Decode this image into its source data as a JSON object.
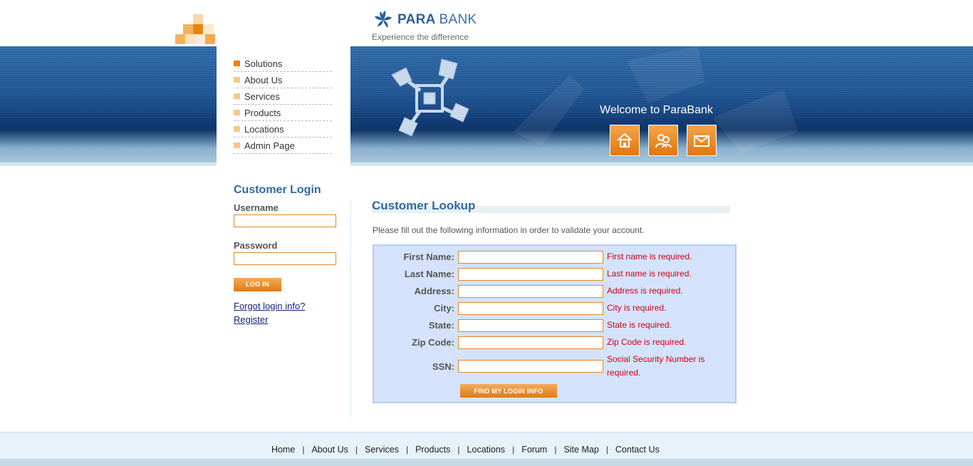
{
  "brand": {
    "name_bold": "PARA",
    "name_thin": "BANK",
    "tagline": "Experience the difference"
  },
  "menu": {
    "items": [
      {
        "label": "Solutions",
        "active": true
      },
      {
        "label": "About Us",
        "active": false
      },
      {
        "label": "Services",
        "active": false
      },
      {
        "label": "Products",
        "active": false
      },
      {
        "label": "Locations",
        "active": false
      },
      {
        "label": "Admin Page",
        "active": false
      }
    ]
  },
  "header": {
    "welcome": "Welcome to ParaBank",
    "icons": [
      "home-icon",
      "contact-people-icon",
      "email-icon"
    ]
  },
  "login": {
    "title": "Customer Login",
    "username_label": "Username",
    "username_value": "",
    "password_label": "Password",
    "password_value": "",
    "login_button": "LOG IN",
    "forgot_link": "Forgot login info?",
    "register_link": "Register"
  },
  "lookup": {
    "title": "Customer Lookup",
    "description": "Please fill out the following information in order to validate your account.",
    "fields": [
      {
        "label": "First Name:",
        "value": "",
        "error": "First name is required."
      },
      {
        "label": "Last Name:",
        "value": "",
        "error": "Last name is required."
      },
      {
        "label": "Address:",
        "value": "",
        "error": "Address is required."
      },
      {
        "label": "City:",
        "value": "",
        "error": "City is required."
      },
      {
        "label": "State:",
        "value": "",
        "error": "State is required."
      },
      {
        "label": "Zip Code:",
        "value": "",
        "error": "Zip Code is required."
      },
      {
        "label": "SSN:",
        "value": "",
        "error": "Social Security Number is required."
      }
    ],
    "submit_button": "FIND MY LOGIN INFO"
  },
  "footer": {
    "links": [
      "Home",
      "About Us",
      "Services",
      "Products",
      "Locations",
      "Forum",
      "Site Map",
      "Contact Us"
    ],
    "separator": "|"
  },
  "colors": {
    "accent_orange": "#e07b12",
    "heading_blue": "#2e6aa4",
    "error_red": "#d0021b",
    "form_bg": "#d4e3fb"
  }
}
